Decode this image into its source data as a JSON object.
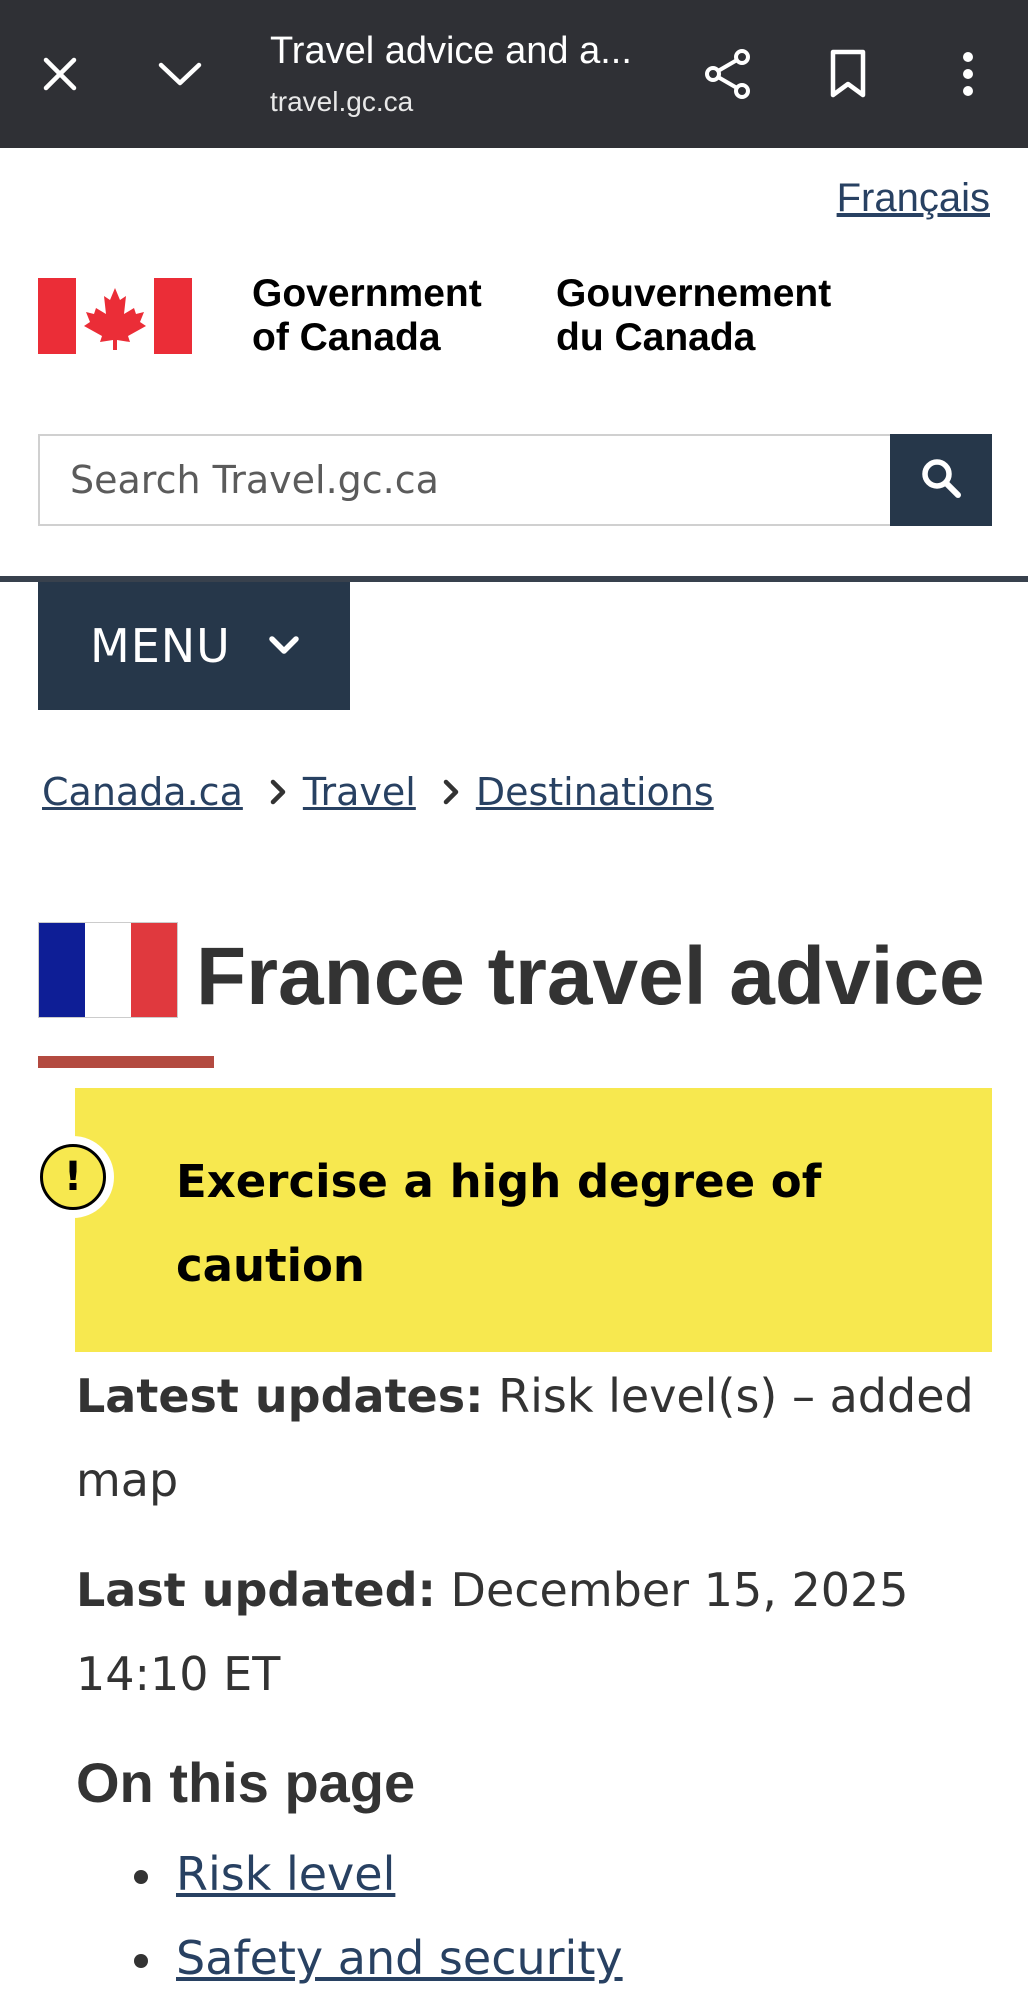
{
  "browser": {
    "title": "Travel advice and a...",
    "url": "travel.gc.ca"
  },
  "header": {
    "language_link": "Français",
    "signature_en_line1": "Government",
    "signature_en_line2": "of Canada",
    "signature_fr_line1": "Gouvernement",
    "signature_fr_line2": "du Canada"
  },
  "search": {
    "placeholder": "Search Travel.gc.ca"
  },
  "menu": {
    "label": "MENU"
  },
  "breadcrumb": [
    "Canada.ca",
    "Travel",
    "Destinations"
  ],
  "page": {
    "title": "France travel advice",
    "risk_alert": "Exercise a high degree of caution",
    "latest_updates_label": "Latest updates:",
    "latest_updates_value": "Risk level(s) – added map",
    "last_updated_label": "Last updated:",
    "last_updated_value": "December 15, 2025 14:10 ET"
  },
  "toc": {
    "heading": "On this page",
    "items": [
      "Risk level",
      "Safety and security"
    ]
  },
  "colors": {
    "chrome_bg": "#2f3035",
    "gc_navy": "#26374a",
    "link": "#284162",
    "alert_yellow": "#f7e84f",
    "canada_red": "#eb2d37",
    "france_blue": "#0e1e96",
    "france_red": "#e0393e"
  }
}
